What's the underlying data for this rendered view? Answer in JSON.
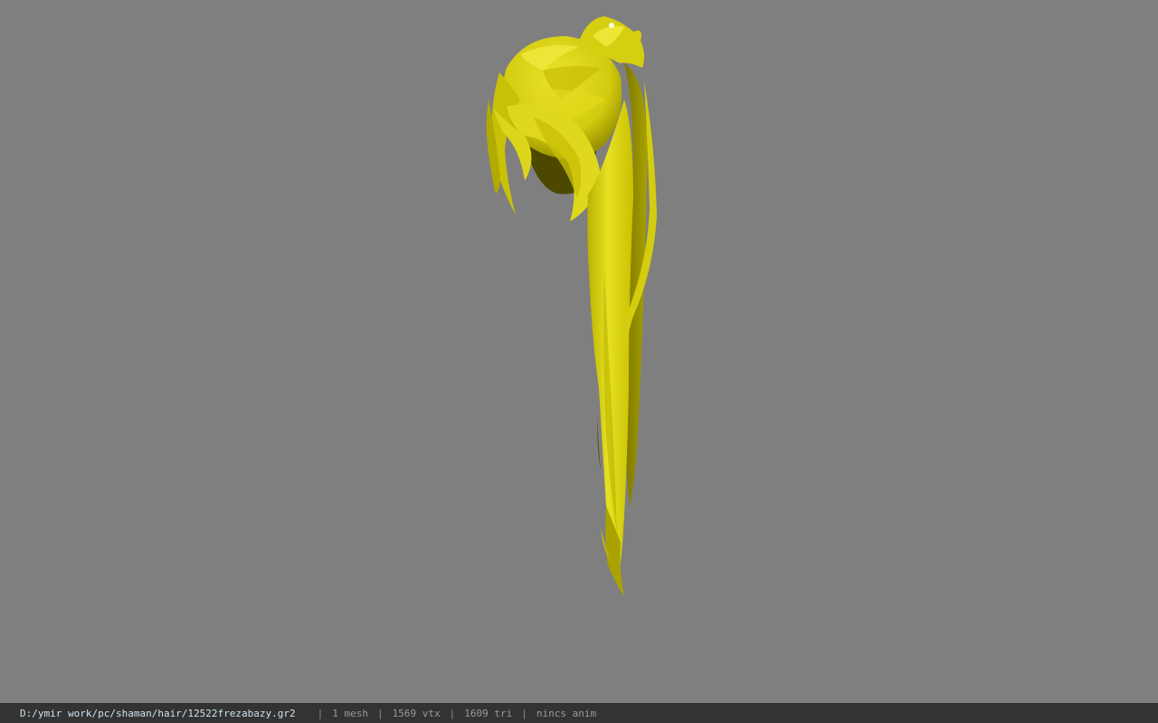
{
  "viewport": {
    "background_color": "#7f7f7f",
    "model_color": "#e4dc1a",
    "model_shadow_color": "#4a4600"
  },
  "status_bar": {
    "file_path": "D:/ymir work/pc/shaman/hair/12522frezabazy.gr2",
    "separator": "|",
    "mesh_count": "1 mesh",
    "vertex_count": "1569 vtx",
    "triangle_count": "1609 tri",
    "anim": "nincs anim",
    "path_color": "#cfe2ee",
    "background_color": "#333333"
  }
}
